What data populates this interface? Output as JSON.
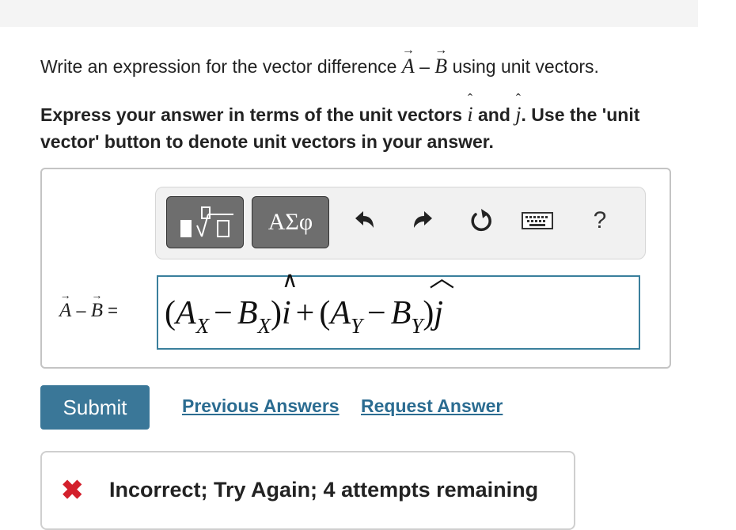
{
  "question": {
    "prompt_before": "Write an expression for the vector difference ",
    "vec_a": "A",
    "minus": " – ",
    "vec_b": "B",
    "prompt_after": " using unit vectors.",
    "instr_1": "Express your answer in terms of the unit vectors ",
    "unit_i": "i",
    "instr_and": " and ",
    "unit_j": "j",
    "instr_2": ". Use the 'unit vector' button to denote unit vectors in your answer."
  },
  "toolbar": {
    "greek_label": "ΑΣφ",
    "help_label": "?",
    "icons": [
      "templates-icon",
      "greek-symbols-button",
      "undo-icon",
      "redo-icon",
      "reset-icon",
      "keyboard-icon",
      "help-icon"
    ]
  },
  "answer": {
    "lhs_a": "A",
    "lhs_minus": " – ",
    "lhs_b": "B",
    "lhs_eq": " =",
    "expr": {
      "open1": "(",
      "ax": "A",
      "ax_sub": "X",
      "minus1": "−",
      "bx": "B",
      "bx_sub": "X",
      "close1": ")",
      "i": "i",
      "plus": "+",
      "open2": "(",
      "ay": "A",
      "ay_sub": "Y",
      "minus2": "−",
      "by": "B",
      "by_sub": "Y",
      "close2": ")",
      "j": "j"
    }
  },
  "actions": {
    "submit": "Submit",
    "previous": "Previous Answers",
    "request": "Request Answer"
  },
  "feedback": {
    "icon": "✖",
    "text": "Incorrect; Try Again; 4 attempts remaining",
    "color": "#d3202c"
  }
}
